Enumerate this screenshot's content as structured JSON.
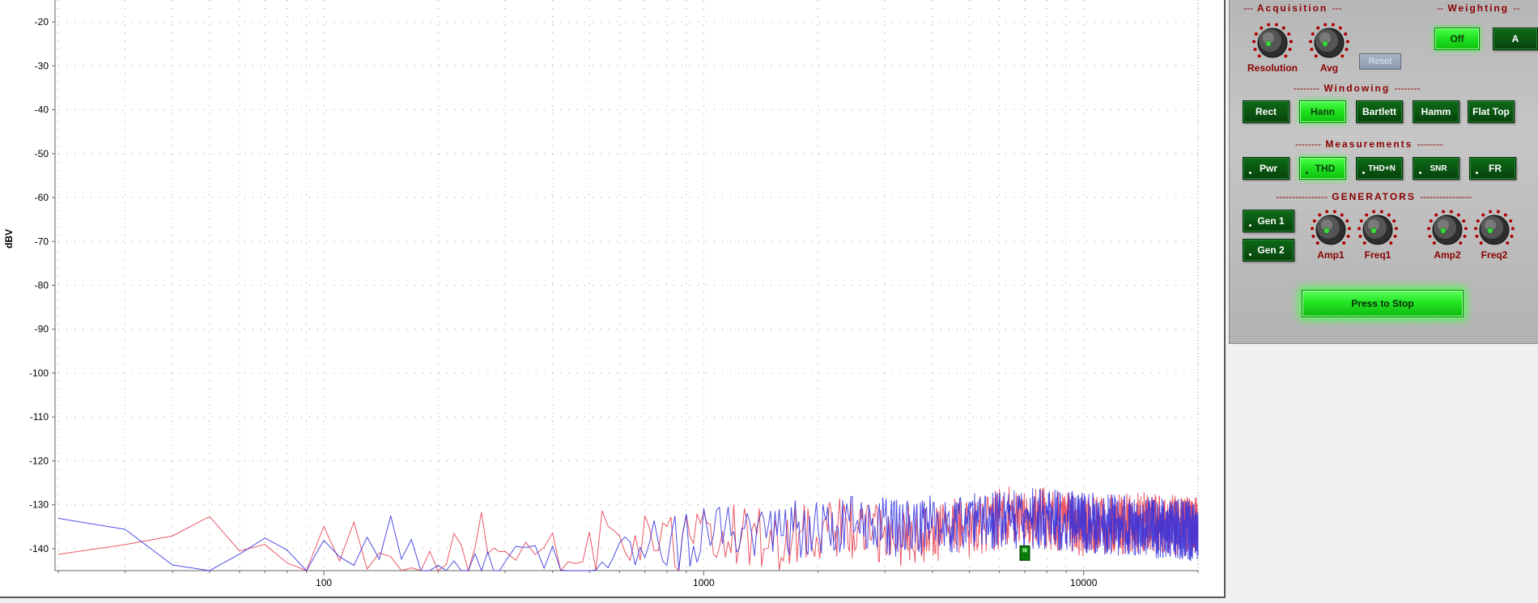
{
  "chart_data": {
    "type": "line",
    "title": "",
    "xlabel": "",
    "ylabel": "dBV",
    "x_scale": "log",
    "xlim": [
      20,
      20000
    ],
    "ylim": [
      -145,
      -15
    ],
    "x_ticks": [
      "100",
      "1000",
      "10000"
    ],
    "y_ticks": [
      "-20",
      "-30",
      "-40",
      "-50",
      "-60",
      "-70",
      "-80",
      "-90",
      "-100",
      "-110",
      "-120",
      "-130",
      "-140"
    ],
    "grid": true,
    "series": [
      {
        "color": "#e83a4a",
        "points": [
          [
            20,
            -134
          ],
          [
            30,
            -135
          ],
          [
            40,
            -137
          ],
          [
            50,
            -135
          ],
          [
            58,
            -129
          ],
          [
            66,
            -138
          ],
          [
            75,
            -135
          ],
          [
            90,
            -141
          ],
          [
            110,
            -133
          ],
          [
            130,
            -134
          ],
          [
            160,
            -146
          ],
          [
            200,
            -140
          ],
          [
            260,
            -134
          ],
          [
            330,
            -132
          ],
          [
            420,
            -138
          ],
          [
            560,
            -133
          ],
          [
            800,
            -136
          ],
          [
            1100,
            -132
          ],
          [
            1600,
            -134
          ],
          [
            2300,
            -131
          ],
          [
            3300,
            -133
          ],
          [
            5000,
            -131
          ],
          [
            7000,
            -128
          ],
          [
            10000,
            -131
          ],
          [
            14000,
            -130
          ],
          [
            20000,
            -131
          ]
        ]
      },
      {
        "color": "#3030e0",
        "points": [
          [
            20,
            -133
          ],
          [
            26,
            -130
          ],
          [
            32,
            -133
          ],
          [
            40,
            -142
          ],
          [
            48,
            -139
          ],
          [
            56,
            -146
          ],
          [
            66,
            -140
          ],
          [
            75,
            -132
          ],
          [
            85,
            -133
          ],
          [
            95,
            -140
          ],
          [
            110,
            -138
          ],
          [
            130,
            -134
          ],
          [
            160,
            -136
          ],
          [
            200,
            -144
          ],
          [
            260,
            -139
          ],
          [
            330,
            -136
          ],
          [
            420,
            -139
          ],
          [
            560,
            -135
          ],
          [
            800,
            -135
          ],
          [
            1100,
            -133
          ],
          [
            1600,
            -132
          ],
          [
            2300,
            -131
          ],
          [
            3300,
            -131
          ],
          [
            5000,
            -130
          ],
          [
            7000,
            -129
          ],
          [
            10000,
            -130
          ],
          [
            14000,
            -131
          ],
          [
            20000,
            -132
          ]
        ]
      }
    ],
    "marker": {
      "x": 7000,
      "y": -141,
      "color": "#0a7a0a"
    }
  },
  "panel": {
    "acquisition": {
      "title": "Acquisition",
      "dashes": "---",
      "resolution": "Resolution",
      "avg": "Avg",
      "reset": "Reset"
    },
    "weighting": {
      "title": "Weighting",
      "dashes": "--",
      "off": "Off",
      "a": "A"
    },
    "windowing": {
      "title": "Windowing",
      "dashes": "--------",
      "buttons": [
        "Rect",
        "Hann",
        "Bartlett",
        "Hamm",
        "Flat Top"
      ],
      "selected": "Hann"
    },
    "measurements": {
      "title": "Measurements",
      "dashes": "--------",
      "buttons": [
        "Pwr",
        "THD",
        "THD+N",
        "SNR",
        "FR"
      ],
      "selected": "THD"
    },
    "generators": {
      "title": "GENERATORS",
      "dashes": "----------------",
      "gen1": "Gen 1",
      "gen2": "Gen 2",
      "amp1": "Amp1",
      "freq1": "Freq1",
      "amp2": "Amp2",
      "freq2": "Freq2"
    },
    "stop": "Press to Stop"
  }
}
